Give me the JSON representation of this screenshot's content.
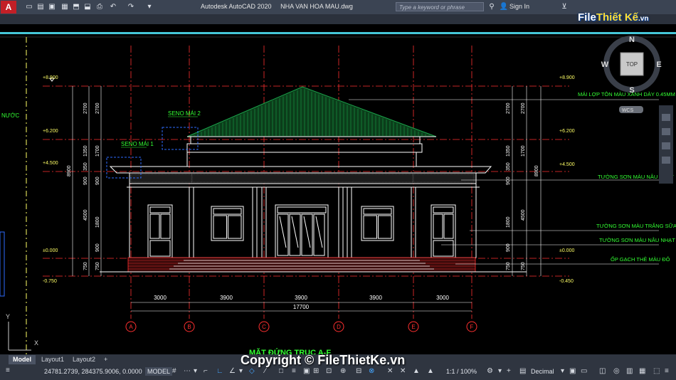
{
  "app": {
    "title": "Autodesk AutoCAD 2020     NHA VAN HOA MAU.dwg",
    "logo_letter": "A",
    "search_placeholder": "Type a keyword or phrase",
    "sign_in": "Sign In"
  },
  "watermark": {
    "brand_main": "File",
    "brand_rest": "Thiết Kế",
    "brand_suffix": ".vn",
    "copyright": "Copyright © FileThietKe.vn"
  },
  "viewcube": {
    "north": "N",
    "south": "S",
    "east": "E",
    "west": "W",
    "face": "TOP",
    "wcs": "WCS"
  },
  "drawing": {
    "title": "MẶT ĐỨNG TRỤC A-F",
    "left_edge_label": "NƯỚC",
    "levels_left": [
      "+8.900",
      "+6.200",
      "+4.500",
      "±0.000",
      "-0.750"
    ],
    "levels_right": [
      "+8.900",
      "+6.200",
      "+4.500",
      "±0.000",
      "-0.450"
    ],
    "dims_outer": [
      "8900"
    ],
    "dims_left_inner": [
      "2700",
      "1350",
      "350",
      "900",
      "4500",
      "1800",
      "900",
      "750"
    ],
    "dims_left_col2": [
      "2700",
      "1700",
      "900",
      "4500",
      "750"
    ],
    "dims_right_inner": [
      "2700",
      "1350",
      "350",
      "900",
      "1800",
      "900",
      "750"
    ],
    "dims_right_col2": [
      "2700",
      "1700",
      "4500",
      "750"
    ],
    "bay_dims": [
      "3000",
      "3900",
      "3900",
      "3900",
      "3000"
    ],
    "total_dim": "17700",
    "axes": [
      "A",
      "B",
      "C",
      "D",
      "E",
      "F"
    ],
    "seno_labels": [
      "SENO MÁI 2",
      "SENO MÁI 1"
    ],
    "notes": [
      "MÁI LỢP TÔN MÀU XANH DÀY 0.45MM",
      "TƯỜNG SƠN MÀU NÂU NHẠT",
      "TƯỜNG SƠN MÀU TRẮNG SỮA",
      "TƯỜNG SƠN MÀU NÂU NHẠT",
      "ỐP GẠCH THẺ MÀU ĐỎ"
    ]
  },
  "layout_tabs": [
    "Model",
    "Layout1",
    "Layout2",
    "+"
  ],
  "status": {
    "coordinates": "24781.2739, 284375.9006, 0.0000",
    "model": "MODEL",
    "scale": "1:1 / 100%",
    "units": "Decimal"
  },
  "colors": {
    "roof": "#1aa34a",
    "line": "#ffffff",
    "red": "#ff3030",
    "yellow": "#ffff66",
    "green_text": "#33ff33",
    "cyan": "#45c7d8",
    "highlight": "#2e6dff"
  }
}
